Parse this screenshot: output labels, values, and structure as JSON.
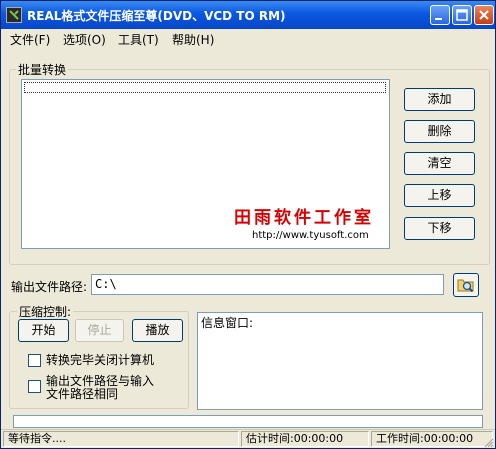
{
  "window": {
    "title": "REAL格式文件压缩至尊(DVD、VCD TO RM)"
  },
  "menu": [
    "文件(F)",
    "选项(O)",
    "工具(T)",
    "帮助(H)"
  ],
  "batch": {
    "label": "批量转换",
    "buttons": [
      "添加",
      "删除",
      "清空",
      "上移",
      "下移"
    ]
  },
  "watermark": {
    "title": "田雨软件工作室",
    "url": "http://www.tyusoft.com"
  },
  "output": {
    "label": "输出文件路径:",
    "value": "C:\\"
  },
  "compress": {
    "label": "压缩控制:",
    "start_label": "开始",
    "stop_label": "停止",
    "play_label": "播放",
    "shutdown_label": "转换完毕关闭计算机",
    "shutdown_checked": false,
    "same_path_label": "输出文件路径与输入文件路径相同",
    "same_path_checked": false
  },
  "info": {
    "label": "信息窗口:"
  },
  "status": {
    "message": "等待指令....",
    "estimated": "估计时间:00:00:00",
    "elapsed": "工作时间:00:00:00"
  },
  "colors": {
    "titlebar": "#0a58e0",
    "watermark_red": "#d80000",
    "disabled_text": "#aca899"
  }
}
